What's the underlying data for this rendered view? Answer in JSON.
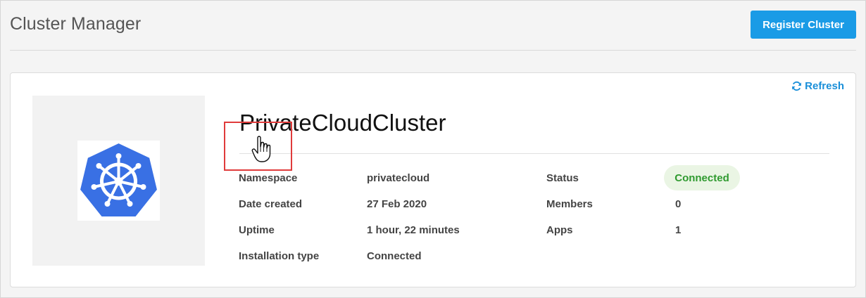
{
  "header": {
    "title": "Cluster Manager",
    "register_label": "Register Cluster"
  },
  "card": {
    "refresh_label": "Refresh",
    "cluster_name": "PrivateCloudCluster",
    "details_left": [
      {
        "label": "Namespace",
        "value": "privatecloud"
      },
      {
        "label": "Date created",
        "value": "27 Feb 2020"
      },
      {
        "label": "Uptime",
        "value": "1 hour, 22 minutes"
      },
      {
        "label": "Installation type",
        "value": "Connected"
      }
    ],
    "details_right": [
      {
        "label": "Status",
        "value": "Connected"
      },
      {
        "label": "Members",
        "value": "0"
      },
      {
        "label": "Apps",
        "value": "1"
      }
    ]
  },
  "colors": {
    "accent": "#1a9be6",
    "status_connected_bg": "#eaf5e4",
    "status_connected_text": "#2f9a2f",
    "kubernetes_blue": "#3970e4",
    "highlight": "#e03b3b"
  },
  "icons": {
    "logo": "kubernetes-logo-icon",
    "refresh": "refresh-icon",
    "cursor": "hand-pointer-cursor-icon"
  }
}
